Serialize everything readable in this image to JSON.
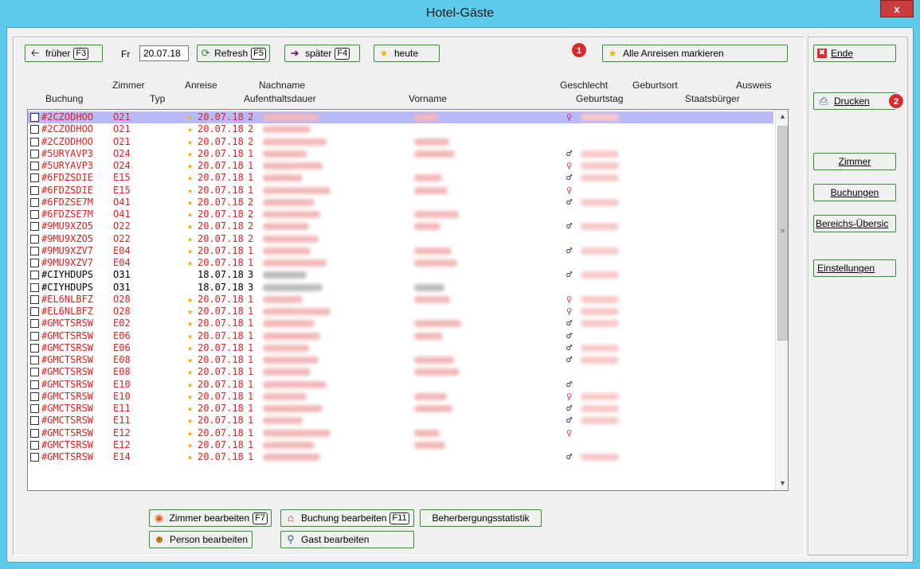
{
  "window": {
    "title": "Hotel-Gäste",
    "close_label": "x"
  },
  "toolbar": {
    "frueher_label": "früher",
    "frueher_key": "F3",
    "day_label": "Fr",
    "date_value": "20.07.18",
    "refresh_label": "Refresh",
    "refresh_key": "F5",
    "spaeter_label": "später",
    "spaeter_key": "F4",
    "heute_label": "heute",
    "mark_all_label": "Alle Anreisen markieren"
  },
  "badges": {
    "one": "1",
    "two": "2"
  },
  "columns": {
    "zimmer": "Zimmer",
    "anreise": "Anreise",
    "nachname": "Nachname",
    "geschlecht": "Geschlecht",
    "geburtsort": "Geburtsort",
    "ausweis": "Ausweis",
    "buchung": "Buchung",
    "typ": "Typ",
    "aufenthaltsdauer": "Aufenthaltsdauer",
    "vorname": "Vorname",
    "geburtstag": "Geburtstag",
    "staatsbuerger": "Staatsbürger"
  },
  "rows": [
    {
      "buchung": "#2CZODHOO",
      "zimmer": "O21",
      "anreise": "20.07.18",
      "dauer": "2",
      "arrival": true,
      "gender": "f",
      "selected": true
    },
    {
      "buchung": "#2CZODHOO",
      "zimmer": "O21",
      "anreise": "20.07.18",
      "dauer": "2",
      "arrival": true,
      "gender": ""
    },
    {
      "buchung": "#2CZODHOO",
      "zimmer": "O21",
      "anreise": "20.07.18",
      "dauer": "2",
      "arrival": true,
      "gender": ""
    },
    {
      "buchung": "#5URYAVP3",
      "zimmer": "O24",
      "anreise": "20.07.18",
      "dauer": "1",
      "arrival": true,
      "gender": "m"
    },
    {
      "buchung": "#5URYAVP3",
      "zimmer": "O24",
      "anreise": "20.07.18",
      "dauer": "1",
      "arrival": true,
      "gender": "f"
    },
    {
      "buchung": "#6FDZSDIE",
      "zimmer": "E15",
      "anreise": "20.07.18",
      "dauer": "1",
      "arrival": true,
      "gender": "m"
    },
    {
      "buchung": "#6FDZSDIE",
      "zimmer": "E15",
      "anreise": "20.07.18",
      "dauer": "1",
      "arrival": true,
      "gender": "f"
    },
    {
      "buchung": "#6FDZSE7M",
      "zimmer": "O41",
      "anreise": "20.07.18",
      "dauer": "2",
      "arrival": true,
      "gender": "m"
    },
    {
      "buchung": "#6FDZSE7M",
      "zimmer": "O41",
      "anreise": "20.07.18",
      "dauer": "2",
      "arrival": true,
      "gender": ""
    },
    {
      "buchung": "#9MU9XZO5",
      "zimmer": "O22",
      "anreise": "20.07.18",
      "dauer": "2",
      "arrival": true,
      "gender": "m"
    },
    {
      "buchung": "#9MU9XZO5",
      "zimmer": "O22",
      "anreise": "20.07.18",
      "dauer": "2",
      "arrival": true,
      "gender": ""
    },
    {
      "buchung": "#9MU9XZV7",
      "zimmer": "E04",
      "anreise": "20.07.18",
      "dauer": "1",
      "arrival": true,
      "gender": "m"
    },
    {
      "buchung": "#9MU9XZV7",
      "zimmer": "E04",
      "anreise": "20.07.18",
      "dauer": "1",
      "arrival": true,
      "gender": ""
    },
    {
      "buchung": "#CIYHDUPS",
      "zimmer": "O31",
      "anreise": "18.07.18",
      "dauer": "3",
      "arrival": false,
      "gender": "m"
    },
    {
      "buchung": "#CIYHDUPS",
      "zimmer": "O31",
      "anreise": "18.07.18",
      "dauer": "3",
      "arrival": false,
      "gender": ""
    },
    {
      "buchung": "#EL6NLBFZ",
      "zimmer": "O28",
      "anreise": "20.07.18",
      "dauer": "1",
      "arrival": true,
      "gender": "f"
    },
    {
      "buchung": "#EL6NLBFZ",
      "zimmer": "O28",
      "anreise": "20.07.18",
      "dauer": "1",
      "arrival": true,
      "gender": "f"
    },
    {
      "buchung": "#GMCTSRSW",
      "zimmer": "E02",
      "anreise": "20.07.18",
      "dauer": "1",
      "arrival": true,
      "gender": "m"
    },
    {
      "buchung": "#GMCTSRSW",
      "zimmer": "E06",
      "anreise": "20.07.18",
      "dauer": "1",
      "arrival": true,
      "gender": "m"
    },
    {
      "buchung": "#GMCTSRSW",
      "zimmer": "E06",
      "anreise": "20.07.18",
      "dauer": "1",
      "arrival": true,
      "gender": "m"
    },
    {
      "buchung": "#GMCTSRSW",
      "zimmer": "E08",
      "anreise": "20.07.18",
      "dauer": "1",
      "arrival": true,
      "gender": "m"
    },
    {
      "buchung": "#GMCTSRSW",
      "zimmer": "E08",
      "anreise": "20.07.18",
      "dauer": "1",
      "arrival": true,
      "gender": ""
    },
    {
      "buchung": "#GMCTSRSW",
      "zimmer": "E10",
      "anreise": "20.07.18",
      "dauer": "1",
      "arrival": true,
      "gender": "m"
    },
    {
      "buchung": "#GMCTSRSW",
      "zimmer": "E10",
      "anreise": "20.07.18",
      "dauer": "1",
      "arrival": true,
      "gender": "f"
    },
    {
      "buchung": "#GMCTSRSW",
      "zimmer": "E11",
      "anreise": "20.07.18",
      "dauer": "1",
      "arrival": true,
      "gender": "m"
    },
    {
      "buchung": "#GMCTSRSW",
      "zimmer": "E11",
      "anreise": "20.07.18",
      "dauer": "1",
      "arrival": true,
      "gender": "m"
    },
    {
      "buchung": "#GMCTSRSW",
      "zimmer": "E12",
      "anreise": "20.07.18",
      "dauer": "1",
      "arrival": true,
      "gender": "f"
    },
    {
      "buchung": "#GMCTSRSW",
      "zimmer": "E12",
      "anreise": "20.07.18",
      "dauer": "1",
      "arrival": true,
      "gender": ""
    },
    {
      "buchung": "#GMCTSRSW",
      "zimmer": "E14",
      "anreise": "20.07.18",
      "dauer": "1",
      "arrival": true,
      "gender": "m"
    }
  ],
  "bottom": {
    "zimmer_bearbeiten": "Zimmer bearbeiten",
    "zimmer_key": "F7",
    "buchung_bearbeiten": "Buchung bearbeiten",
    "buchung_key": "F11",
    "statistik": "Beherbergungsstatistik",
    "person_bearbeiten": "Person bearbeiten",
    "gast_bearbeiten": "Gast bearbeiten"
  },
  "side": {
    "ende": "Ende",
    "drucken": "Drucken",
    "zimmer": "Zimmer",
    "buchungen": "Buchungen",
    "bereich": "Bereichs-Übersic",
    "einstellungen": "Einstellungen"
  },
  "colors": {
    "arrival": "#e01f1f",
    "selection": "#b9b9f5",
    "accent_green": "#3d8a3d",
    "titlebar": "#5fcbeb"
  }
}
